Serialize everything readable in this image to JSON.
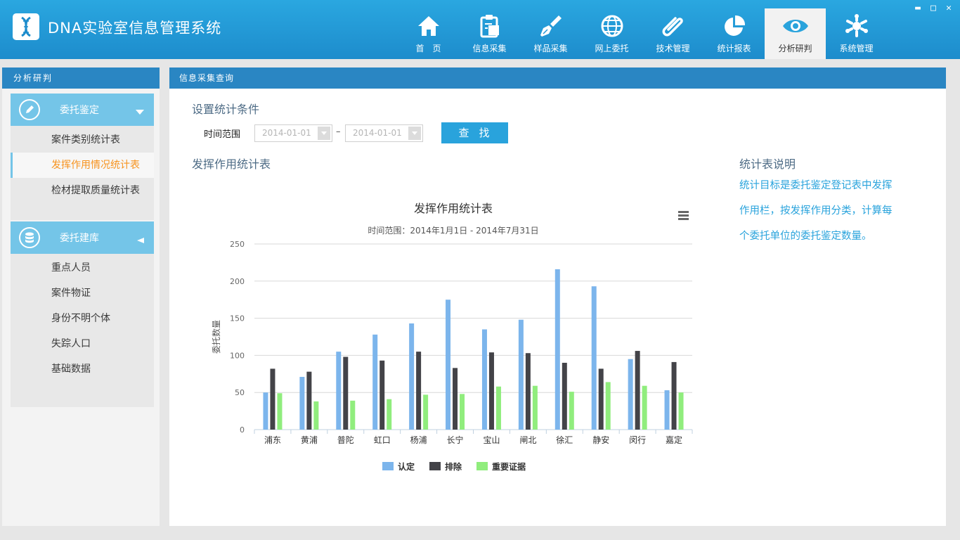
{
  "app": {
    "title": "DNA实验室信息管理系统",
    "logo_icon": "dna-icon"
  },
  "window_controls": {
    "minimize": "▬",
    "maximize": "□",
    "close": "✕"
  },
  "nav": {
    "items": [
      {
        "label": "首　页",
        "icon": "home-icon"
      },
      {
        "label": "信息采集",
        "icon": "clipboard-icon"
      },
      {
        "label": "样品采集",
        "icon": "brush-icon"
      },
      {
        "label": "网上委托",
        "icon": "globe-icon"
      },
      {
        "label": "技术管理",
        "icon": "paperclip-icon"
      },
      {
        "label": "统计报表",
        "icon": "pie-chart-icon"
      },
      {
        "label": "分析研判",
        "icon": "eye-icon",
        "active": true
      },
      {
        "label": "系统管理",
        "icon": "settings-icon"
      }
    ]
  },
  "sidebar": {
    "header": "分析研判",
    "groups": [
      {
        "label": "委托鉴定",
        "icon": "pencil-icon",
        "items": [
          {
            "label": "案件类别统计表"
          },
          {
            "label": "发挥作用情况统计表",
            "active": true
          },
          {
            "label": "检材提取质量统计表"
          }
        ]
      },
      {
        "label": "委托建库",
        "icon": "database-icon",
        "items": [
          {
            "label": "重点人员"
          },
          {
            "label": "案件物证"
          },
          {
            "label": "身份不明个体"
          },
          {
            "label": "失踪人口"
          },
          {
            "label": "基础数据"
          }
        ]
      }
    ]
  },
  "main": {
    "header": "信息采集查询",
    "conditions_title": "设置统计条件",
    "time_range_label": "时间范围",
    "date_from": "2014-01-01",
    "date_to": "2014-01-01",
    "dash": "–",
    "search_button": "查找",
    "table_title": "发挥作用统计表",
    "description": {
      "title": "统计表说明",
      "text": "统计目标是委托鉴定登记表中发挥作用栏，按发挥作用分类，计算每个委托单位的委托鉴定数量。"
    }
  },
  "colors": {
    "accent": "#29a3dc",
    "header_bar": "#2a86c3",
    "group_head": "#74c5e8",
    "active_text": "#f7931e",
    "text_dark": "#3a7290",
    "series": [
      "#7cb5ec",
      "#434348",
      "#90ed7d"
    ]
  },
  "chart_data": {
    "type": "bar",
    "title": "发挥作用统计表",
    "subtitle": "时间范围：2014年1月1日 - 2014年7月31日",
    "menu_icon": "hamburger-menu-icon",
    "xlabel": "",
    "ylabel": "委托数量",
    "ylim": [
      0,
      250
    ],
    "yticks": [
      0,
      50,
      100,
      150,
      200,
      250
    ],
    "grid": true,
    "legend_position": "bottom",
    "categories": [
      "浦东",
      "黄浦",
      "普陀",
      "虹口",
      "杨浦",
      "长宁",
      "宝山",
      "闸北",
      "徐汇",
      "静安",
      "闵行",
      "嘉定"
    ],
    "series": [
      {
        "name": "认定",
        "color": "#7cb5ec",
        "values": [
          50,
          71,
          105,
          128,
          143,
          175,
          135,
          148,
          216,
          193,
          95,
          53
        ]
      },
      {
        "name": "排除",
        "color": "#434348",
        "values": [
          82,
          78,
          98,
          93,
          105,
          83,
          104,
          103,
          90,
          82,
          106,
          91
        ]
      },
      {
        "name": "重要证据",
        "color": "#90ed7d",
        "values": [
          49,
          38,
          39,
          41,
          47,
          48,
          58,
          59,
          51,
          64,
          59,
          50
        ]
      }
    ]
  }
}
